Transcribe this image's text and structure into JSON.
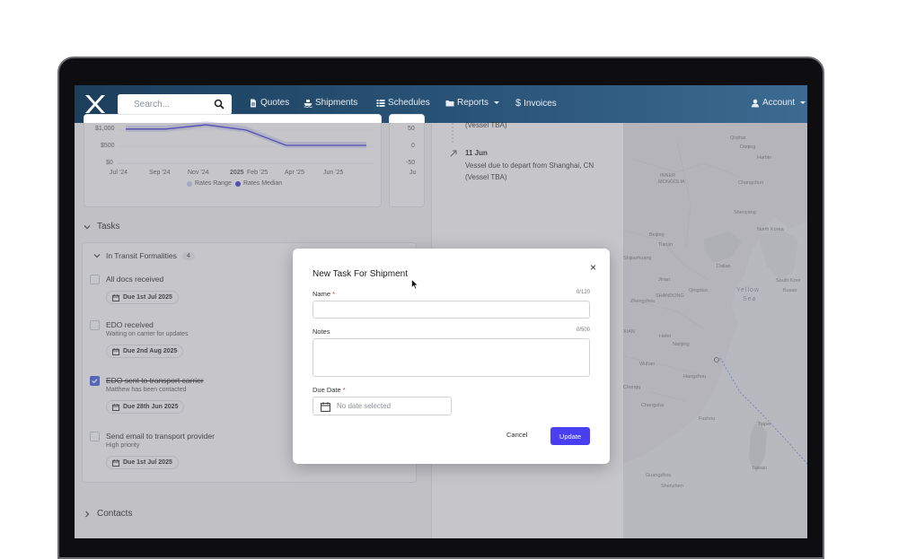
{
  "navbar": {
    "search_placeholder": "Search...",
    "items": [
      {
        "label": "Quotes",
        "icon": "document-icon"
      },
      {
        "label": "Shipments",
        "icon": "ship-icon"
      },
      {
        "label": "Schedules",
        "icon": "list-icon"
      },
      {
        "label": "Reports",
        "icon": "folder-icon",
        "dropdown": true
      },
      {
        "label": "Invoices",
        "icon": "dollar-icon"
      }
    ],
    "account_label": "Account"
  },
  "rates_chart": {
    "y_ticks": [
      "$1,000",
      "$500",
      "$0"
    ],
    "x_ticks": [
      "Jul '24",
      "Sep '24",
      "Nov '24",
      "2025",
      "Feb '25",
      "Apr '25",
      "Jun '25"
    ],
    "right_ticks": [
      "50",
      "0",
      "-50"
    ],
    "right_x_tick": "Ju",
    "legend": [
      "Rates Range",
      "Rates Median"
    ],
    "colors": {
      "range": "#c9c7f2",
      "median": "#3b2fd6"
    },
    "chart_data": {
      "type": "area",
      "categories": [
        "Jul '24",
        "Sep '24",
        "Nov '24",
        "2025",
        "Feb '25",
        "Apr '25",
        "Jun '25"
      ],
      "series": [
        {
          "name": "Rates Median",
          "values": [
            1050,
            1050,
            1180,
            1020,
            550,
            550,
            550
          ]
        }
      ],
      "ylim": [
        0,
        1100
      ]
    }
  },
  "tasks": {
    "section_label": "Tasks",
    "group_label": "In Transit Formalities",
    "group_count": "4",
    "items": [
      {
        "title": "All docs received",
        "subtitle": "",
        "due": "Due 1st Jul 2025",
        "checked": false
      },
      {
        "title": "EDO received",
        "subtitle": "Waiting on carrier for updates",
        "due": "Due 2nd Aug 2025",
        "checked": false
      },
      {
        "title": "EDO sent to transport carrier",
        "subtitle": "Matthew has been contacted",
        "due": "Due 28th Jun 2025",
        "checked": true
      },
      {
        "title": "Send email to transport provider",
        "subtitle": "High priority",
        "due": "Due 1st Jul 2025",
        "checked": false
      }
    ]
  },
  "contacts": {
    "section_label": "Contacts"
  },
  "timeline": {
    "prev_text": "(Vessel TBA)",
    "date": "11 Jun",
    "text1": "Vessel due to depart from Shanghai, CN",
    "text2": "(Vessel TBA)"
  },
  "map": {
    "labels": [
      "Qiqihar",
      "Daqing",
      "Harbin",
      "INNER",
      "MONGOLIA",
      "Changchun",
      "Shenyang",
      "North Korea",
      "Beijing",
      "Tianjin",
      "South Kore",
      "Busan",
      "Shijiazhuang",
      "Dalian",
      "Jinan",
      "Qingdao",
      "Zhengzhou",
      "SHANDONG",
      "Hefei",
      "Nanjing",
      "Wuhan",
      "Hangzhou",
      "Chongq",
      "Changsha",
      "Fuzhou",
      "Taipei",
      "Taiwan",
      "Guangzhou",
      "Shenzhen",
      "XIAN"
    ],
    "sea_labels": [
      "Yellow",
      "Sea"
    ]
  },
  "modal": {
    "title": "New Task For Shipment",
    "name_label": "Name",
    "name_count": "0/120",
    "name_value": "",
    "notes_label": "Notes",
    "notes_count": "0/500",
    "notes_value": "",
    "due_label": "Due Date",
    "due_placeholder": "No date selected",
    "cancel_label": "Cancel",
    "update_label": "Update",
    "close_symbol": "×",
    "required_mark": "*"
  }
}
